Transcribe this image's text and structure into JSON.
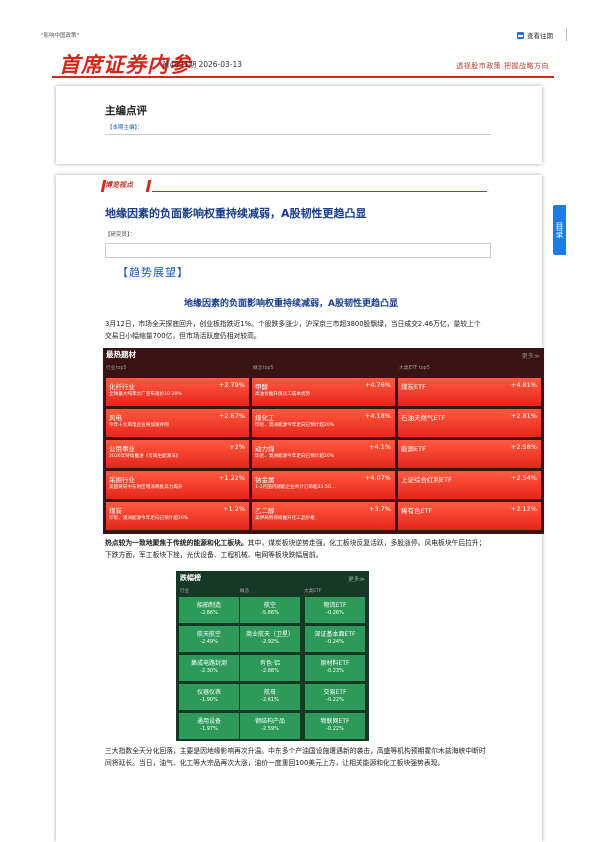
{
  "top": {
    "left_text": "\"影响中国政策\"",
    "right_text": "查看往期",
    "right_icon": "calendar-icon"
  },
  "header": {
    "title": "首席证券内参",
    "issue": "第4001期 2026-03-13",
    "slogan": "透视股市政策 把握战略方向"
  },
  "editorial": {
    "heading": "主编点评",
    "editor_label": "【本期主编】："
  },
  "section": {
    "viewpoint_tag": "博览视点",
    "title": "地缘因素的负面影响权重持续减弱，A股韧性更趋凸显",
    "researcher_label": "【研究员】：",
    "trend_label": "【趋势展望】",
    "sub_title": "地缘因素的负面影响权重持续减弱，A股韧性更趋凸显",
    "paragraph1": "3月12日，市场全天探底回升，创业板指跌近1%。个股跌多涨少，沪深京三市超3800股飘绿，当日成交2.46万亿，量较上个交易日小幅缩量700亿，但市场活跃度仍相对较高。",
    "paragraph2_bold": "热点较为一致地聚焦于传统的能源和化工板块。",
    "paragraph2_rest": "其中，煤炭板块逆势走强，化工板块反复活跃，多股涨停。风电板块午后拉升；下跌方面，军工板块下挫，光伏设备、工程机械、电网等板块跌幅居前。",
    "paragraph3": "三大指数全天分化回落，主要是因地缘影响再次升温。中东多个产油国设施遭遇新的袭击，高盛等机构预期霍尔木兹海峡中断时间将延长。当日，油气、化工等大宗品再次大涨，油价一度重回100美元上方，让相关能源和化工板块强势表现。"
  },
  "hot": {
    "title": "最热题材",
    "more": "更多≫",
    "col_headers": [
      "行业top5",
      "概念top5",
      "大类ETF top5"
    ],
    "rows": [
      [
        {
          "name": "化纤行业",
          "pct": "+2.79%",
          "desc": "全球最大纯苯大厂宣布涨价10-20%"
        },
        {
          "name": "甲醇",
          "pct": "+4.76%",
          "desc": "高油价推升煤化工成本优势"
        },
        {
          "name": "煤炭ETF",
          "pct": "+4.81%",
          "desc": ""
        }
      ],
      [
        {
          "name": "风电",
          "pct": "+2.67%",
          "desc": "今年十大风电企业将加速并网"
        },
        {
          "name": "煤化工",
          "pct": "+4.18%",
          "desc": "印尼、澳洲能源今年走向已预计超20%"
        },
        {
          "name": "石油天然气ETF",
          "pct": "+2.81%",
          "desc": ""
        }
      ],
      [
        {
          "name": "公用事业",
          "pct": "+2%",
          "desc": "2026年持续推进《可再生能源法》"
        },
        {
          "name": "动力煤",
          "pct": "+4.1%",
          "desc": "印尼、澳洲能源今年走向已预计超20%"
        },
        {
          "name": "能源ETF",
          "pct": "+2.58%",
          "desc": ""
        }
      ],
      [
        {
          "name": "采掘行业",
          "pct": "+1.22%",
          "desc": "美国将向中东地区增派两批兵力再升"
        },
        {
          "name": "钠金属",
          "pct": "+4.07%",
          "desc": "1-2月国内储能企业共计订单超33.5G..."
        },
        {
          "name": "上证综合红利ETF",
          "pct": "+2.54%",
          "desc": ""
        }
      ],
      [
        {
          "name": "煤炭",
          "pct": "+1.2%",
          "desc": "印尼、澳洲能源今年走向已预计超20%"
        },
        {
          "name": "乙二醇",
          "pct": "+3.7%",
          "desc": "美伊局势持续推升化工品价格"
        },
        {
          "name": "稀有色ETF",
          "pct": "+2.12%",
          "desc": ""
        }
      ]
    ]
  },
  "fall": {
    "title": "跌幅榜",
    "more": "更多≫",
    "col_headers": [
      "行业",
      "概念",
      "大类ETF"
    ],
    "rows": [
      [
        {
          "name": "船舶制造",
          "pct": "-2.86%"
        },
        {
          "name": "航空",
          "pct": "-5.86%"
        },
        {
          "name": "物流ETF",
          "pct": "-0.26%"
        }
      ],
      [
        {
          "name": "航天航空",
          "pct": "-2.49%"
        },
        {
          "name": "商业航天（卫星）",
          "pct": "-2.92%"
        },
        {
          "name": "深证基本面ETF",
          "pct": "-0.24%"
        }
      ],
      [
        {
          "name": "集成电路封测",
          "pct": "-2.30%"
        },
        {
          "name": "有色·铝",
          "pct": "-2.88%"
        },
        {
          "name": "原材料ETF",
          "pct": "-0.23%"
        }
      ],
      [
        {
          "name": "仪器仪表",
          "pct": "-1.90%"
        },
        {
          "name": "航母",
          "pct": "-2.61%"
        },
        {
          "name": "交易ETF",
          "pct": "-0.22%"
        }
      ],
      [
        {
          "name": "通用设备",
          "pct": "-1.97%"
        },
        {
          "name": "钢结构产品",
          "pct": "-2.59%"
        },
        {
          "name": "物联网ETF",
          "pct": "-0.22%"
        }
      ]
    ]
  },
  "toc": {
    "label": "目录"
  },
  "colors": {
    "brand_red": "#d9261c",
    "title_blue": "#1a3d8c",
    "hot_cell": "#f03a2a",
    "fall_cell": "#2e9a5a"
  }
}
